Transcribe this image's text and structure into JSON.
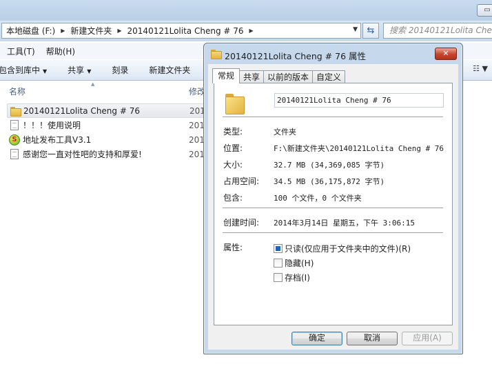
{
  "explorer": {
    "breadcrumb": [
      "本地磁盘 (F:)",
      "新建文件夹",
      "20140121Lolita Cheng # 76"
    ],
    "search_placeholder": "搜索 20140121Lolita Cheng",
    "menu": [
      "工具(T)",
      "帮助(H)"
    ],
    "toolbar": {
      "include_library": "包含到库中",
      "share": "共享",
      "burn": "刻录",
      "new_folder": "新建文件夹"
    },
    "columns": {
      "name": "名称",
      "date": "修改"
    },
    "files": [
      {
        "name": "20140121Lolita Cheng # 76",
        "date": "201",
        "icon": "folder-icon",
        "selected": true
      },
      {
        "name": "！！！使用说明",
        "date": "201",
        "icon": "text-file-icon"
      },
      {
        "name": "地址发布工具V3.1",
        "date": "201",
        "icon": "app-icon"
      },
      {
        "name": "感谢您一直对性吧的支持和厚爱!",
        "date": "201",
        "icon": "text-file-icon"
      }
    ]
  },
  "dialog": {
    "title": "20140121Lolita Cheng # 76 属性",
    "tabs": [
      "常规",
      "共享",
      "以前的版本",
      "自定义"
    ],
    "name": "20140121Lolita Cheng # 76",
    "type_label": "类型:",
    "type_value": "文件夹",
    "location_label": "位置:",
    "location_value": "F:\\新建文件夹\\20140121Lolita Cheng # 76",
    "size_label": "大小:",
    "size_value": "32.7 MB (34,369,085 字节)",
    "size_on_disk_label": "占用空间:",
    "size_on_disk_value": "34.5 MB (36,175,872 字节)",
    "contains_label": "包含:",
    "contains_value": "100 个文件，0 个文件夹",
    "created_label": "创建时间:",
    "created_value": "2014年3月14日 星期五，下午 3:06:15",
    "attributes_label": "属性:",
    "attributes": [
      {
        "label": "只读(仅应用于文件夹中的文件)(R)",
        "state": "indeterminate"
      },
      {
        "label": "隐藏(H)",
        "state": "unchecked"
      },
      {
        "label": "存档(I)",
        "state": "unchecked"
      }
    ],
    "buttons": {
      "ok": "确定",
      "cancel": "取消",
      "apply": "应用(A)"
    }
  }
}
